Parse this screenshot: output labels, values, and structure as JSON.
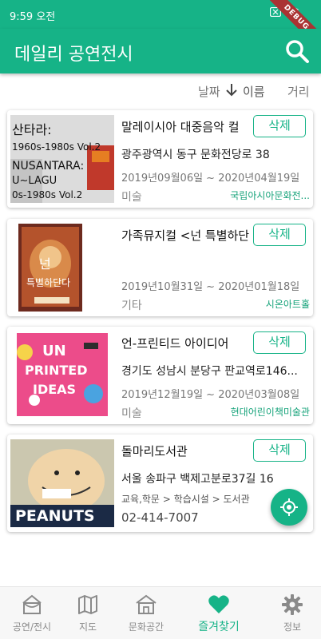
{
  "status_bar": {
    "time": "9:59 오전",
    "debug_label": "DEBUG"
  },
  "app_bar": {
    "title": "데일리 공연전시"
  },
  "sort": {
    "date": "날짜",
    "name": "이름",
    "distance": "거리"
  },
  "cards": [
    {
      "title": "말레이시아 대중음악 컬",
      "address": "광주광역시 동구 문화전당로 38",
      "period": "2019년09월06일 ~ 2020년04월19일",
      "category": "미술",
      "venue": "국립아시아문화전...",
      "delete_label": "삭제",
      "thumb_lines": [
        "산타라:",
        "1960s-1980s Vol.2",
        "NUSANTARA:",
        "U~LAGU",
        "0s-1980s Vol.2"
      ]
    },
    {
      "title": "가족뮤지컬 <넌 특별하단",
      "address": "",
      "period": "2019년10월31일 ~ 2020년01월18일",
      "category": "기타",
      "venue": "시온아트홀",
      "delete_label": "삭제",
      "thumb_lines": [
        "넌",
        "특별하단다"
      ]
    },
    {
      "title": "언-프린티드 아이디어",
      "address": "경기도 성남시 분당구 판교역로146...",
      "period": "2019년12월19일 ~ 2020년03월08일",
      "category": "미술",
      "venue": "현대어린이책미술관",
      "delete_label": "삭제",
      "thumb_lines": [
        "UN",
        "PRINTED",
        "IDEAS"
      ]
    },
    {
      "title": "돌마리도서관",
      "address": "서울 송파구 백제고분로37길 16",
      "path": "교육,학문 > 학습시설 > 도서관",
      "phone": "02-414-7007",
      "delete_label": "삭제",
      "thumb_lines": [
        "PEANUTS"
      ]
    }
  ],
  "bottom_nav": [
    {
      "label": "공연/전시",
      "icon": "theater-icon",
      "active": false
    },
    {
      "label": "지도",
      "icon": "map-icon",
      "active": false
    },
    {
      "label": "문화공간",
      "icon": "building-icon",
      "active": false
    },
    {
      "label": "즐겨찾기",
      "icon": "heart-icon",
      "active": true
    },
    {
      "label": "정보",
      "icon": "gear-icon",
      "active": false
    }
  ],
  "colors": {
    "primary": "#16b387",
    "venue_text": "#16a37a"
  }
}
